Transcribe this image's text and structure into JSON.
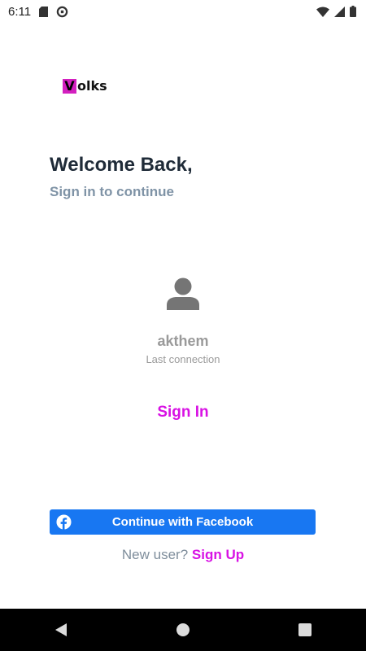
{
  "status_bar": {
    "time": "6:11",
    "left_icons": [
      "sd-card-icon",
      "data-saver-icon"
    ],
    "right_icons": [
      "wifi-icon",
      "signal-icon",
      "battery-icon"
    ]
  },
  "logo": {
    "initial": "V",
    "rest": "olks",
    "accent_color": "#d31fbf"
  },
  "welcome": {
    "title": "Welcome Back,",
    "subtitle": "Sign in to continue"
  },
  "account": {
    "username": "akthem",
    "caption": "Last connection"
  },
  "sign_in_label": "Sign In",
  "facebook_button": {
    "label": "Continue with Facebook",
    "color": "#1877f2"
  },
  "signup_prompt": {
    "text": "New user?",
    "link": "Sign Up"
  },
  "accent_color": "#d812e4",
  "nav_bar": [
    "back-icon",
    "home-icon",
    "recents-icon"
  ]
}
